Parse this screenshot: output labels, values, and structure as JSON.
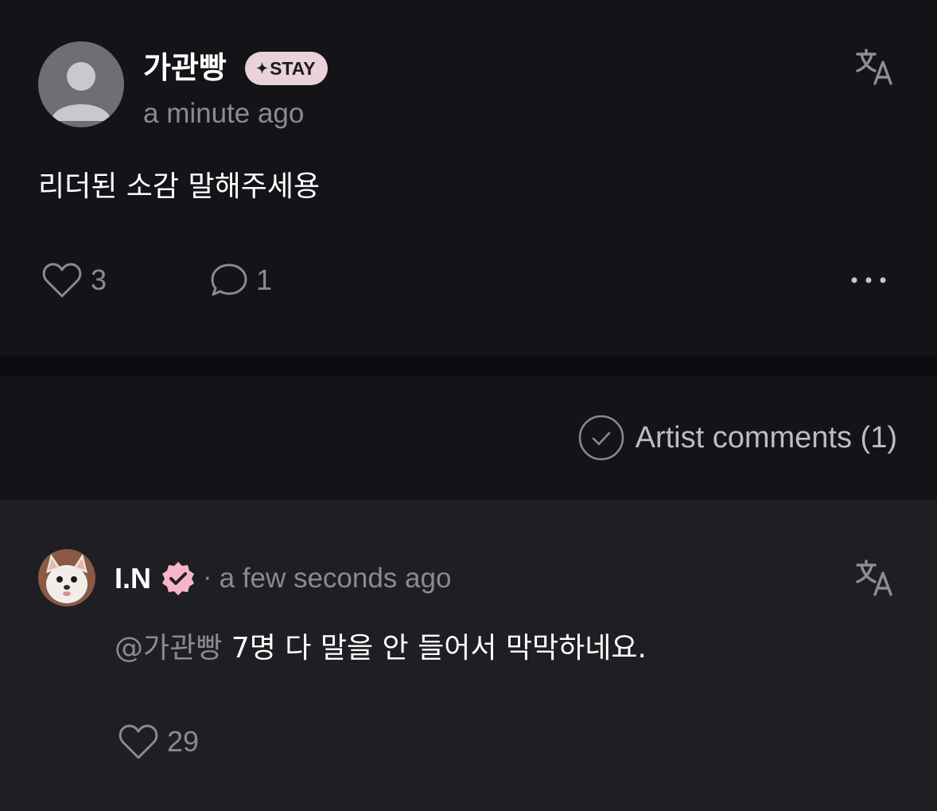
{
  "post": {
    "username": "가관빵",
    "badge": {
      "icon": "sparkle-icon",
      "label": "STAY",
      "color": "#e9d3d8"
    },
    "time": "a minute ago",
    "text": "리더된 소감 말해주세용",
    "likes": "3",
    "comments": "1",
    "translate_icon": "translate-icon",
    "more_icon": "more-horizontal-icon"
  },
  "artist_comments": {
    "label": "Artist comments (1)",
    "icon": "check-circle-icon"
  },
  "comment": {
    "author": "I.N",
    "verified_icon": "verified-badge-icon",
    "verified_color": "#f7b6c8",
    "separator": "·",
    "time": "a few seconds ago",
    "mention": "@가관빵",
    "text": "7명 다 말을 안 들어서 막막하네요.",
    "likes": "29",
    "translate_icon": "translate-icon"
  }
}
